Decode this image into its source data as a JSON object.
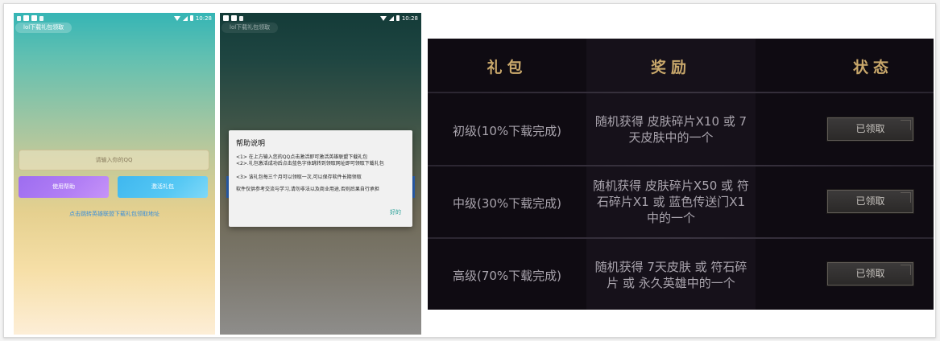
{
  "statusbar": {
    "time": "10:28"
  },
  "phone1": {
    "tab": "lol下载礼包领取",
    "qq_placeholder": "请输入你的QQ",
    "help_button": "使用帮助",
    "activate_button": "激活礼包",
    "link_text": "点击跳转英雄联盟下载礼包领取地址"
  },
  "phone2": {
    "tab": "lol下载礼包领取",
    "dialog": {
      "title": "帮助说明",
      "line1": "<1> 在上方输入您的QQ点击激活即可激活英雄联盟下载礼包",
      "line2": "<2>.礼包激活成功后点击蓝色字体跳转到领取网址即可领取下载礼包",
      "line3": "<3> 该礼包每三个月可以领取一次,可以保存软件长期领取",
      "line4": "软件仅供参考交流与学习,请勿非法以及商业用途,否则后果自行承担",
      "ok": "好的"
    }
  },
  "reward_table": {
    "headers": {
      "package": "礼包",
      "reward": "奖励",
      "status": "状态"
    },
    "rows": [
      {
        "level": "初级(10%下载完成)",
        "reward": "随机获得 皮肤碎片X10 或 7天皮肤中的一个",
        "status": "已领取"
      },
      {
        "level": "中级(30%下载完成)",
        "reward": "随机获得 皮肤碎片X50 或 符石碎片X1 或 蓝色传送门X1中的一个",
        "status": "已领取"
      },
      {
        "level": "高级(70%下载完成)",
        "reward": "随机获得 7天皮肤 或 符石碎片 或 永久英雄中的一个",
        "status": "已领取"
      }
    ]
  },
  "colors": {
    "gold": "#c9a86b",
    "table_bg": "#0f0b12",
    "help_button": "#a274f2",
    "activate_button": "#4cc0f1",
    "link": "#3b8fd9"
  }
}
